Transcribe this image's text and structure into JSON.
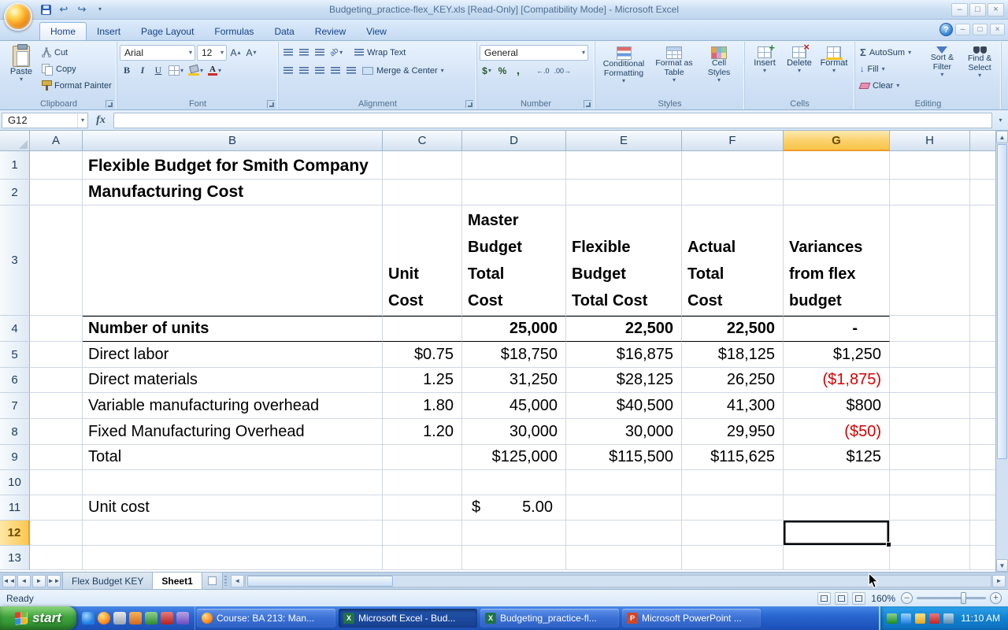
{
  "window": {
    "title": "Budgeting_practice-flex_KEY.xls  [Read-Only]  [Compatibility Mode] - Microsoft Excel"
  },
  "ribbon": {
    "tabs": [
      {
        "label": "Home",
        "active": true
      },
      {
        "label": "Insert"
      },
      {
        "label": "Page Layout"
      },
      {
        "label": "Formulas"
      },
      {
        "label": "Data"
      },
      {
        "label": "Review"
      },
      {
        "label": "View"
      }
    ],
    "clipboard": {
      "group": "Clipboard",
      "paste": "Paste",
      "cut": "Cut",
      "copy": "Copy",
      "format_painter": "Format Painter"
    },
    "font": {
      "group": "Font",
      "family": "Arial",
      "size": "12",
      "bold": "B",
      "italic": "I",
      "underline": "U"
    },
    "alignment": {
      "group": "Alignment",
      "wrap_text": "Wrap Text",
      "merge_center": "Merge & Center"
    },
    "number": {
      "group": "Number",
      "format": "General",
      "currency": "$",
      "percent": "%",
      "comma": ","
    },
    "styles": {
      "group": "Styles",
      "conditional": "Conditional Formatting",
      "as_table": "Format as Table",
      "cell_styles": "Cell Styles"
    },
    "cells": {
      "group": "Cells",
      "insert": "Insert",
      "delete": "Delete",
      "format": "Format"
    },
    "editing": {
      "group": "Editing",
      "autosum": "AutoSum",
      "fill": "Fill",
      "clear": "Clear",
      "sort_filter": "Sort & Filter",
      "find_select": "Find & Select"
    }
  },
  "formula_bar": {
    "name_box": "G12",
    "fx": "fx"
  },
  "grid": {
    "selection": {
      "col": "G",
      "row": 12
    },
    "columns": [
      "A",
      "B",
      "C",
      "D",
      "E",
      "F",
      "G",
      "H"
    ],
    "rows": [
      {
        "n": 1,
        "cells": {
          "B": {
            "t": "Flexible Budget for Smith Company",
            "b": true,
            "big": true
          }
        }
      },
      {
        "n": 2,
        "cells": {
          "B": {
            "t": "Manufacturing Cost",
            "b": true,
            "big": true
          }
        }
      },
      {
        "n": 3,
        "cells": {
          "C": {
            "t": "Unit\nCost",
            "b": true,
            "multi": true
          },
          "D": {
            "t": "Master\nBudget\nTotal\nCost",
            "b": true,
            "multi": true
          },
          "E": {
            "t": "Flexible\nBudget\nTotal Cost",
            "b": true,
            "multi": true
          },
          "F": {
            "t": "Actual\nTotal\nCost",
            "b": true,
            "multi": true
          },
          "G": {
            "t": "Variances\nfrom flex\nbudget",
            "b": true,
            "multi": true
          }
        }
      },
      {
        "n": 4,
        "cells": {
          "B": {
            "t": "Number of units",
            "b": true,
            "bd": true
          },
          "C": {
            "bd": true
          },
          "D": {
            "t": "25,000",
            "b": true,
            "r": true,
            "bd": true
          },
          "E": {
            "t": "22,500",
            "b": true,
            "r": true,
            "bd": true
          },
          "F": {
            "t": "22,500",
            "b": true,
            "r": true,
            "bd": true
          },
          "G": {
            "t": "-",
            "b": true,
            "r": true,
            "bd": true,
            "dash": true
          }
        }
      },
      {
        "n": 5,
        "cells": {
          "B": {
            "t": "Direct labor"
          },
          "C": {
            "t": "$0.75",
            "r": true
          },
          "D": {
            "t": "$18,750",
            "r": true
          },
          "E": {
            "t": "$16,875",
            "r": true
          },
          "F": {
            "t": "$18,125",
            "r": true
          },
          "G": {
            "t": "$1,250",
            "r": true
          }
        }
      },
      {
        "n": 6,
        "cells": {
          "B": {
            "t": "Direct materials"
          },
          "C": {
            "t": "1.25",
            "r": true
          },
          "D": {
            "t": "31,250",
            "r": true
          },
          "E": {
            "t": "$28,125",
            "r": true
          },
          "F": {
            "t": "26,250",
            "r": true
          },
          "G": {
            "t": "($1,875)",
            "r": true,
            "red": true
          }
        }
      },
      {
        "n": 7,
        "cells": {
          "B": {
            "t": "Variable manufacturing overhead"
          },
          "C": {
            "t": "1.80",
            "r": true
          },
          "D": {
            "t": "45,000",
            "r": true
          },
          "E": {
            "t": "$40,500",
            "r": true
          },
          "F": {
            "t": "41,300",
            "r": true
          },
          "G": {
            "t": "$800",
            "r": true
          }
        }
      },
      {
        "n": 8,
        "cells": {
          "B": {
            "t": "Fixed Manufacturing Overhead"
          },
          "C": {
            "t": "1.20",
            "r": true
          },
          "D": {
            "t": "30,000",
            "r": true
          },
          "E": {
            "t": "30,000",
            "r": true
          },
          "F": {
            "t": "29,950",
            "r": true
          },
          "G": {
            "t": "($50)",
            "r": true,
            "red": true
          }
        }
      },
      {
        "n": 9,
        "cells": {
          "B": {
            "t": "Total"
          },
          "D": {
            "t": "$125,000",
            "r": true
          },
          "E": {
            "t": "$115,500",
            "r": true
          },
          "F": {
            "t": "$115,625",
            "r": true
          },
          "G": {
            "t": "$125",
            "r": true
          }
        }
      },
      {
        "n": 10,
        "cells": {}
      },
      {
        "n": 11,
        "cells": {
          "B": {
            "t": "Unit cost"
          },
          "D": {
            "acct": true,
            "cur": "$",
            "t": "5.00"
          }
        }
      },
      {
        "n": 12,
        "cells": {}
      },
      {
        "n": 13,
        "cells": {}
      }
    ]
  },
  "sheet_tabs": [
    {
      "label": "Flex Budget KEY",
      "active": false
    },
    {
      "label": "Sheet1",
      "active": true
    }
  ],
  "status": {
    "mode": "Ready",
    "zoom": "160%"
  },
  "taskbar": {
    "start": "start",
    "tasks": [
      {
        "label": "Course: BA 213: Man...",
        "icon": "firefox"
      },
      {
        "label": "Microsoft Excel - Bud...",
        "icon": "excel",
        "active": true
      },
      {
        "label": "Budgeting_practice-fl...",
        "icon": "excel"
      },
      {
        "label": "Microsoft PowerPoint ...",
        "icon": "powerpoint"
      }
    ],
    "clock": "11:10 AM"
  }
}
